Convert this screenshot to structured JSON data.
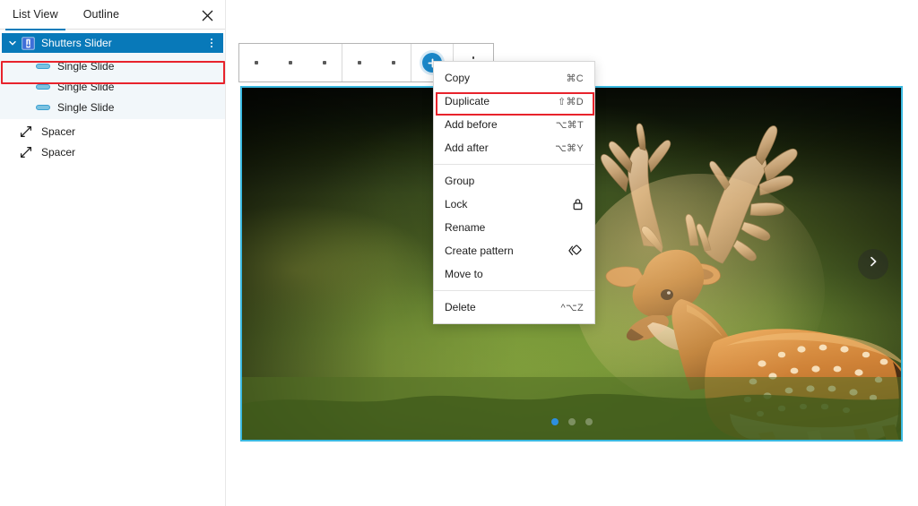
{
  "panel": {
    "tabs": [
      {
        "label": "List View",
        "active": true
      },
      {
        "label": "Outline",
        "active": false
      }
    ],
    "close_icon": "close-icon",
    "tree": {
      "parent": {
        "label": "Shutters Slider",
        "icon": "slider-block-icon",
        "expand_icon": "chevron-down-icon",
        "options_icon": "vertical-dots-icon",
        "selected": true,
        "selection_color": "#0879b9"
      },
      "children": [
        {
          "label": "Single Slide",
          "icon": "single-slide-icon"
        },
        {
          "label": "Single Slide",
          "icon": "single-slide-icon"
        },
        {
          "label": "Single Slide",
          "icon": "single-slide-icon"
        }
      ],
      "siblings": [
        {
          "label": "Spacer",
          "icon": "spacer-icon"
        },
        {
          "label": "Spacer",
          "icon": "spacer-icon"
        }
      ]
    }
  },
  "toolbar": {
    "add_block_icon": "plus-icon",
    "options_icon": "vertical-dots-icon",
    "accent": "#1a87c8"
  },
  "context_menu": {
    "items": [
      {
        "label": "Copy",
        "shortcut": "⌘C",
        "icon": "",
        "highlighted": false
      },
      {
        "label": "Duplicate",
        "shortcut": "⇧⌘D",
        "icon": "",
        "highlighted": true
      },
      {
        "label": "Add before",
        "shortcut": "⌥⌘T",
        "icon": "",
        "highlighted": false
      },
      {
        "label": "Add after",
        "shortcut": "⌥⌘Y",
        "icon": "",
        "highlighted": false
      },
      {
        "separator": true
      },
      {
        "label": "Group",
        "shortcut": "",
        "icon": "",
        "highlighted": false
      },
      {
        "label": "Lock",
        "shortcut": "",
        "icon": "lock-icon",
        "highlighted": false
      },
      {
        "label": "Rename",
        "shortcut": "",
        "icon": "",
        "highlighted": false
      },
      {
        "label": "Create pattern",
        "shortcut": "",
        "icon": "pattern-icon",
        "highlighted": false
      },
      {
        "label": "Move to",
        "shortcut": "",
        "icon": "",
        "highlighted": false
      },
      {
        "separator": true
      },
      {
        "label": "Delete",
        "shortcut": "^⌥Z",
        "icon": "",
        "highlighted": false
      }
    ],
    "highlight_color": "#e8232c"
  },
  "slider": {
    "selected_border_color": "#3bb9e0",
    "image_alt": "Fallow deer buck with large palmate antlers standing in a sunlit green meadow",
    "next_icon": "chevron-right-icon",
    "dots": [
      {
        "active": true
      },
      {
        "active": false
      },
      {
        "active": false
      }
    ],
    "active_dot_color": "#2d8fe0"
  }
}
